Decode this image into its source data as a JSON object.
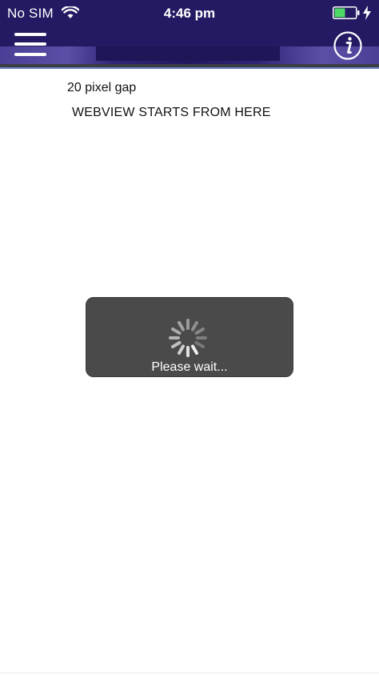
{
  "status_bar": {
    "carrier": "No SIM",
    "time": "4:46 pm",
    "wifi_icon": "wifi-icon",
    "battery_icon": "battery-icon",
    "charging_icon": "charging-bolt-icon",
    "battery_level": 0.45,
    "battery_color": "#4cd964"
  },
  "header": {
    "menu_icon": "hamburger-menu-icon",
    "info_icon": "info-icon",
    "color": "#231a63"
  },
  "content": {
    "gap_label": "20 pixel gap",
    "webview_label": "WEBVIEW STARTS FROM HERE"
  },
  "loading": {
    "message": "Please wait...",
    "spinner_icon": "spinner-icon"
  }
}
